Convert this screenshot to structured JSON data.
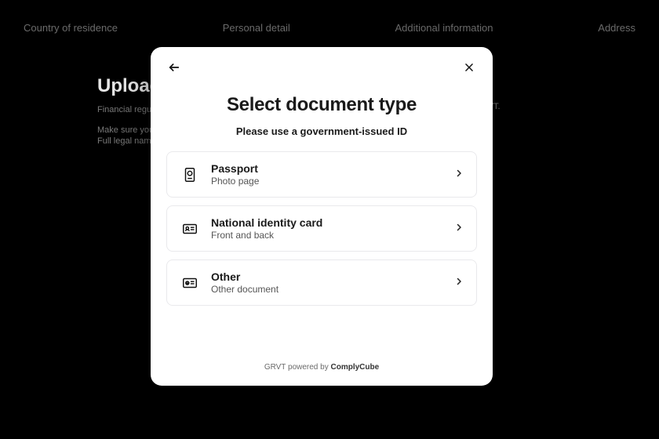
{
  "stepper": {
    "items": [
      {
        "label": "Country of residence"
      },
      {
        "label": "Personal detail"
      },
      {
        "label": "Additional information"
      },
      {
        "label": "Address"
      }
    ]
  },
  "background": {
    "title": "Upload",
    "line1": "Financial regul",
    "line2": "Make sure you",
    "line3": "Full legal name",
    "tail": "/T."
  },
  "modal": {
    "title": "Select document type",
    "subtitle": "Please use a government-issued ID",
    "options": [
      {
        "title": "Passport",
        "sub": "Photo page"
      },
      {
        "title": "National identity card",
        "sub": "Front and back"
      },
      {
        "title": "Other",
        "sub": "Other document"
      }
    ],
    "footer_prefix": "GRVT powered by ",
    "footer_brand": "ComplyCube"
  }
}
